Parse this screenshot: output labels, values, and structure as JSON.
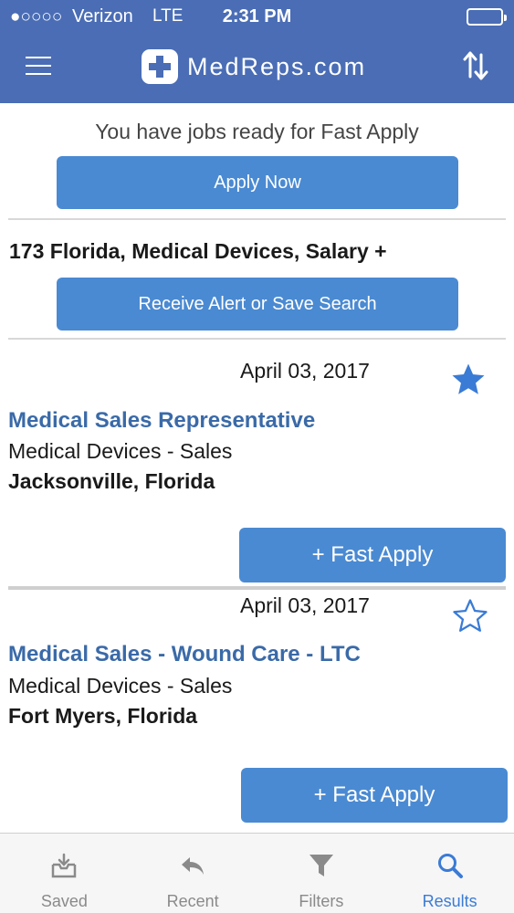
{
  "status": {
    "signal": "●○○○○",
    "carrier": "Verizon",
    "network": "LTE",
    "time": "2:31 PM"
  },
  "header": {
    "brand": "MedReps.com",
    "menu_icon": "hamburger-menu-icon",
    "sort_icon": "sort-arrows-icon"
  },
  "promo": {
    "text": "You have jobs ready for Fast Apply",
    "button": "Apply Now"
  },
  "search": {
    "summary": "173 Florida, Medical Devices, Salary +",
    "save_button": "Receive Alert or Save Search"
  },
  "jobs": [
    {
      "date": "April 03, 2017",
      "starred": true,
      "title": "Medical Sales Representative",
      "category": "Medical Devices  -  Sales",
      "location": "Jacksonville, Florida",
      "apply": "+ Fast Apply"
    },
    {
      "date": "April 03, 2017",
      "starred": false,
      "title": "Medical Sales - Wound Care - LTC",
      "category": "Medical Devices  -  Sales",
      "location": "Fort Myers, Florida",
      "apply": "+ Fast Apply"
    }
  ],
  "tabs": [
    {
      "label": "Saved",
      "icon": "saved-tray-icon"
    },
    {
      "label": "Recent",
      "icon": "back-arrow-icon"
    },
    {
      "label": "Filters",
      "icon": "funnel-icon"
    },
    {
      "label": "Results",
      "icon": "search-icon",
      "active": true
    }
  ],
  "colors": {
    "header": "#4a6db5",
    "button": "#4a8ad2",
    "job_title": "#3a6aa8",
    "star": "#3a7bd5",
    "active_tab": "#3a7bd5"
  }
}
